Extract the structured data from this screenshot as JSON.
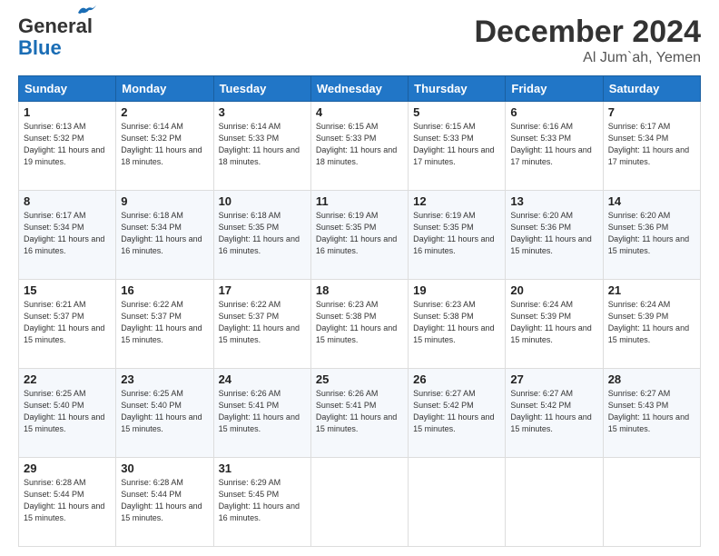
{
  "header": {
    "logo_general": "General",
    "logo_blue": "Blue",
    "month_title": "December 2024",
    "location": "Al Jum`ah, Yemen"
  },
  "days_of_week": [
    "Sunday",
    "Monday",
    "Tuesday",
    "Wednesday",
    "Thursday",
    "Friday",
    "Saturday"
  ],
  "weeks": [
    [
      {
        "day": "1",
        "sunrise": "6:13 AM",
        "sunset": "5:32 PM",
        "daylight": "11 hours and 19 minutes."
      },
      {
        "day": "2",
        "sunrise": "6:14 AM",
        "sunset": "5:32 PM",
        "daylight": "11 hours and 18 minutes."
      },
      {
        "day": "3",
        "sunrise": "6:14 AM",
        "sunset": "5:33 PM",
        "daylight": "11 hours and 18 minutes."
      },
      {
        "day": "4",
        "sunrise": "6:15 AM",
        "sunset": "5:33 PM",
        "daylight": "11 hours and 18 minutes."
      },
      {
        "day": "5",
        "sunrise": "6:15 AM",
        "sunset": "5:33 PM",
        "daylight": "11 hours and 17 minutes."
      },
      {
        "day": "6",
        "sunrise": "6:16 AM",
        "sunset": "5:33 PM",
        "daylight": "11 hours and 17 minutes."
      },
      {
        "day": "7",
        "sunrise": "6:17 AM",
        "sunset": "5:34 PM",
        "daylight": "11 hours and 17 minutes."
      }
    ],
    [
      {
        "day": "8",
        "sunrise": "6:17 AM",
        "sunset": "5:34 PM",
        "daylight": "11 hours and 16 minutes."
      },
      {
        "day": "9",
        "sunrise": "6:18 AM",
        "sunset": "5:34 PM",
        "daylight": "11 hours and 16 minutes."
      },
      {
        "day": "10",
        "sunrise": "6:18 AM",
        "sunset": "5:35 PM",
        "daylight": "11 hours and 16 minutes."
      },
      {
        "day": "11",
        "sunrise": "6:19 AM",
        "sunset": "5:35 PM",
        "daylight": "11 hours and 16 minutes."
      },
      {
        "day": "12",
        "sunrise": "6:19 AM",
        "sunset": "5:35 PM",
        "daylight": "11 hours and 16 minutes."
      },
      {
        "day": "13",
        "sunrise": "6:20 AM",
        "sunset": "5:36 PM",
        "daylight": "11 hours and 15 minutes."
      },
      {
        "day": "14",
        "sunrise": "6:20 AM",
        "sunset": "5:36 PM",
        "daylight": "11 hours and 15 minutes."
      }
    ],
    [
      {
        "day": "15",
        "sunrise": "6:21 AM",
        "sunset": "5:37 PM",
        "daylight": "11 hours and 15 minutes."
      },
      {
        "day": "16",
        "sunrise": "6:22 AM",
        "sunset": "5:37 PM",
        "daylight": "11 hours and 15 minutes."
      },
      {
        "day": "17",
        "sunrise": "6:22 AM",
        "sunset": "5:37 PM",
        "daylight": "11 hours and 15 minutes."
      },
      {
        "day": "18",
        "sunrise": "6:23 AM",
        "sunset": "5:38 PM",
        "daylight": "11 hours and 15 minutes."
      },
      {
        "day": "19",
        "sunrise": "6:23 AM",
        "sunset": "5:38 PM",
        "daylight": "11 hours and 15 minutes."
      },
      {
        "day": "20",
        "sunrise": "6:24 AM",
        "sunset": "5:39 PM",
        "daylight": "11 hours and 15 minutes."
      },
      {
        "day": "21",
        "sunrise": "6:24 AM",
        "sunset": "5:39 PM",
        "daylight": "11 hours and 15 minutes."
      }
    ],
    [
      {
        "day": "22",
        "sunrise": "6:25 AM",
        "sunset": "5:40 PM",
        "daylight": "11 hours and 15 minutes."
      },
      {
        "day": "23",
        "sunrise": "6:25 AM",
        "sunset": "5:40 PM",
        "daylight": "11 hours and 15 minutes."
      },
      {
        "day": "24",
        "sunrise": "6:26 AM",
        "sunset": "5:41 PM",
        "daylight": "11 hours and 15 minutes."
      },
      {
        "day": "25",
        "sunrise": "6:26 AM",
        "sunset": "5:41 PM",
        "daylight": "11 hours and 15 minutes."
      },
      {
        "day": "26",
        "sunrise": "6:27 AM",
        "sunset": "5:42 PM",
        "daylight": "11 hours and 15 minutes."
      },
      {
        "day": "27",
        "sunrise": "6:27 AM",
        "sunset": "5:42 PM",
        "daylight": "11 hours and 15 minutes."
      },
      {
        "day": "28",
        "sunrise": "6:27 AM",
        "sunset": "5:43 PM",
        "daylight": "11 hours and 15 minutes."
      }
    ],
    [
      {
        "day": "29",
        "sunrise": "6:28 AM",
        "sunset": "5:44 PM",
        "daylight": "11 hours and 15 minutes."
      },
      {
        "day": "30",
        "sunrise": "6:28 AM",
        "sunset": "5:44 PM",
        "daylight": "11 hours and 15 minutes."
      },
      {
        "day": "31",
        "sunrise": "6:29 AM",
        "sunset": "5:45 PM",
        "daylight": "11 hours and 16 minutes."
      },
      null,
      null,
      null,
      null
    ]
  ]
}
